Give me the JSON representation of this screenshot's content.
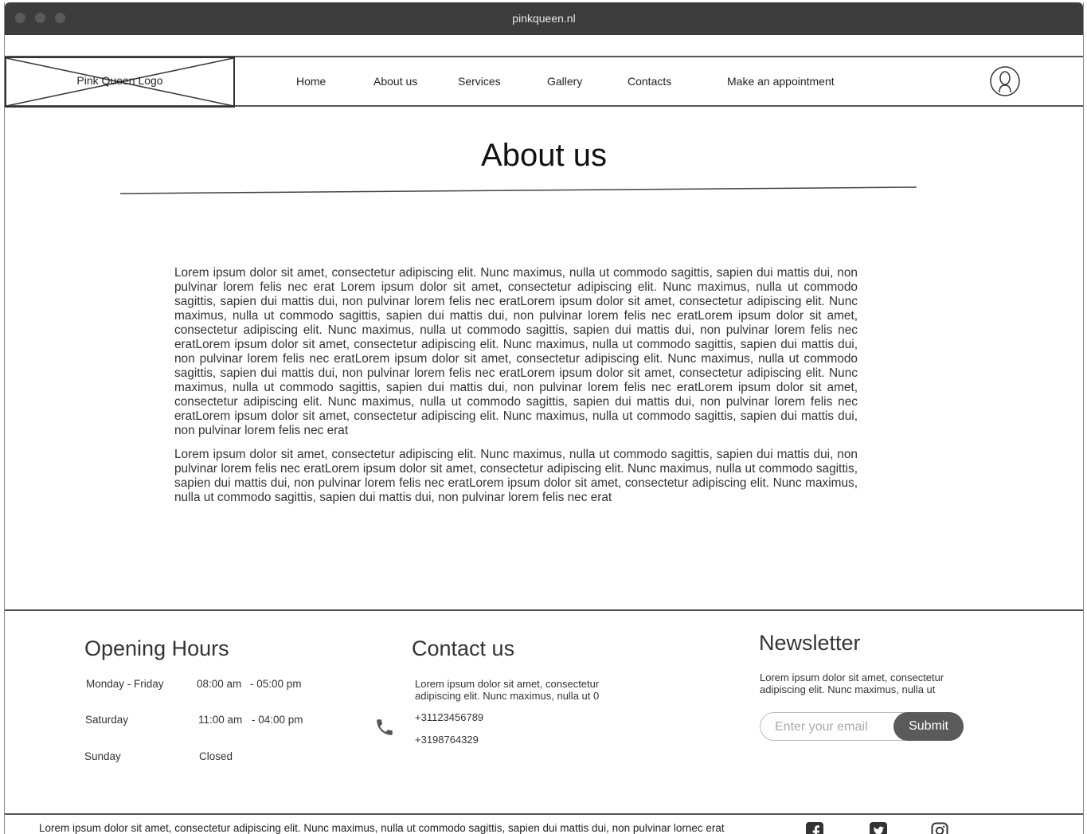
{
  "browser": {
    "domain": "pinkqueen.nl"
  },
  "header": {
    "logo_label": "Pink Queen Logo",
    "nav": [
      {
        "label": "Home"
      },
      {
        "label": "About us"
      },
      {
        "label": "Services"
      },
      {
        "label": "Gallery"
      },
      {
        "label": "Contacts"
      },
      {
        "label": "Make an appointment"
      }
    ],
    "avatar_icon": "user-avatar-icon"
  },
  "main": {
    "title": "About us",
    "paragraphs": [
      "Lorem ipsum dolor sit amet, consectetur adipiscing elit. Nunc maximus, nulla ut commodo sagittis, sapien dui mattis dui, non pulvinar lorem felis nec erat Lorem ipsum dolor sit amet, consectetur adipiscing elit. Nunc maximus, nulla ut commodo sagittis, sapien dui mattis dui, non pulvinar lorem felis nec eratLorem ipsum dolor sit amet, consectetur adipiscing elit. Nunc maximus, nulla ut commodo sagittis, sapien dui mattis dui, non pulvinar lorem felis nec eratLorem ipsum dolor sit amet, consectetur adipiscing elit. Nunc maximus, nulla ut commodo sagittis, sapien dui mattis dui, non pulvinar lorem felis nec eratLorem ipsum dolor sit amet, consectetur adipiscing elit. Nunc maximus, nulla ut commodo sagittis, sapien dui mattis dui, non pulvinar lorem felis nec eratLorem ipsum dolor sit amet, consectetur adipiscing elit. Nunc maximus, nulla ut commodo sagittis, sapien dui mattis dui, non pulvinar lorem felis nec eratLorem ipsum dolor sit amet, consectetur adipiscing elit. Nunc maximus, nulla ut commodo sagittis, sapien dui mattis dui, non pulvinar lorem felis nec eratLorem ipsum dolor sit amet, consectetur adipiscing elit. Nunc maximus, nulla ut commodo sagittis, sapien dui mattis dui, non pulvinar lorem felis nec eratLorem ipsum dolor sit amet, consectetur adipiscing elit. Nunc maximus, nulla ut commodo sagittis, sapien dui mattis dui, non pulvinar lorem felis nec erat",
      "Lorem ipsum dolor sit amet, consectetur adipiscing elit. Nunc maximus, nulla ut commodo sagittis, sapien dui mattis dui, non pulvinar lorem felis nec eratLorem ipsum dolor sit amet, consectetur adipiscing elit. Nunc maximus, nulla ut commodo sagittis, sapien dui mattis dui, non pulvinar lorem felis nec eratLorem ipsum dolor sit amet, consectetur adipiscing elit. Nunc maximus, nulla ut commodo sagittis, sapien dui mattis dui, non pulvinar lorem felis nec erat"
    ]
  },
  "footer": {
    "opening_hours": {
      "title": "Opening Hours",
      "rows": [
        {
          "day": "Monday - Friday",
          "open": "08:00 am",
          "close": "- 05:00 pm"
        },
        {
          "day": "Saturday",
          "open": "11:00 am",
          "close": "- 04:00 pm"
        },
        {
          "day": "Sunday",
          "open": "Closed",
          "close": ""
        }
      ]
    },
    "contact": {
      "title": "Contact us",
      "text": "Lorem ipsum dolor sit amet, consectetur adipiscing elit. Nunc maximus, nulla ut 0",
      "phone1": "+31123456789",
      "phone2": "+3198764329",
      "icon": "phone-icon"
    },
    "newsletter": {
      "title": "Newsletter",
      "text": "Lorem ipsum dolor sit amet, consectetur adipiscing elit. Nunc maximus, nulla ut",
      "email_placeholder": "Enter your email",
      "submit_label": "Submit"
    },
    "bottom_text": "Lorem ipsum dolor sit amet, consectetur adipiscing elit. Nunc maximus, nulla ut commodo sagittis, sapien dui mattis dui, non pulvinar lornec erat",
    "social_icons": [
      "facebook-icon",
      "twitter-icon",
      "instagram-icon"
    ]
  }
}
